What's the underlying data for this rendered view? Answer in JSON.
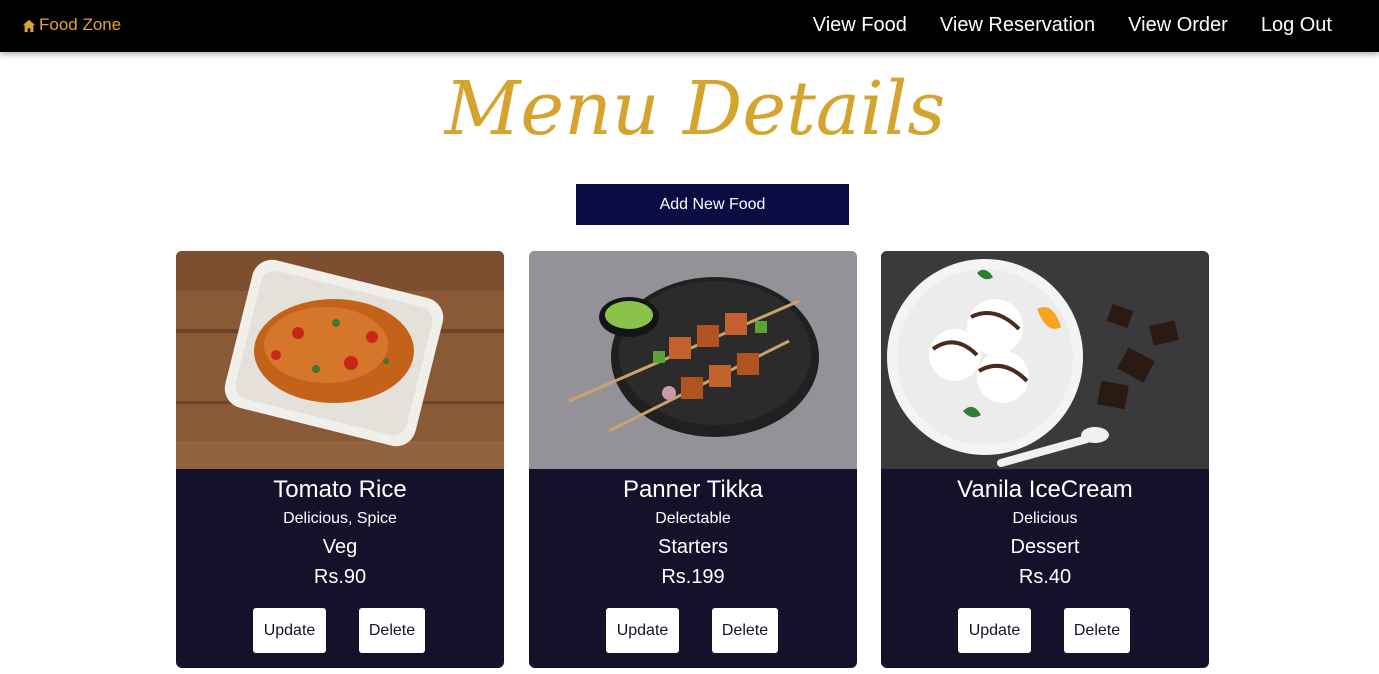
{
  "navbar": {
    "brand_icon": "home-icon",
    "brand": "Food Zone",
    "links": [
      "View Food",
      "View Reservation",
      "View Order",
      "Log Out"
    ]
  },
  "page": {
    "title": "Menu Details",
    "add_button": "Add New Food"
  },
  "items": [
    {
      "name": "Tomato Rice",
      "description": "Delicious, Spice",
      "category": "Veg",
      "price": "Rs.90",
      "update_label": "Update",
      "delete_label": "Delete"
    },
    {
      "name": "Panner Tikka",
      "description": "Delectable",
      "category": "Starters",
      "price": "Rs.199",
      "update_label": "Update",
      "delete_label": "Delete"
    },
    {
      "name": "Vanila IceCream",
      "description": "Delicious",
      "category": "Dessert",
      "price": "Rs.40",
      "update_label": "Update",
      "delete_label": "Delete"
    }
  ],
  "colors": {
    "navbar_bg": "#000000",
    "brand": "#e0a52c",
    "title": "#d4a42e",
    "add_button_bg": "#0c0c45",
    "card_bg": "#14122b"
  }
}
